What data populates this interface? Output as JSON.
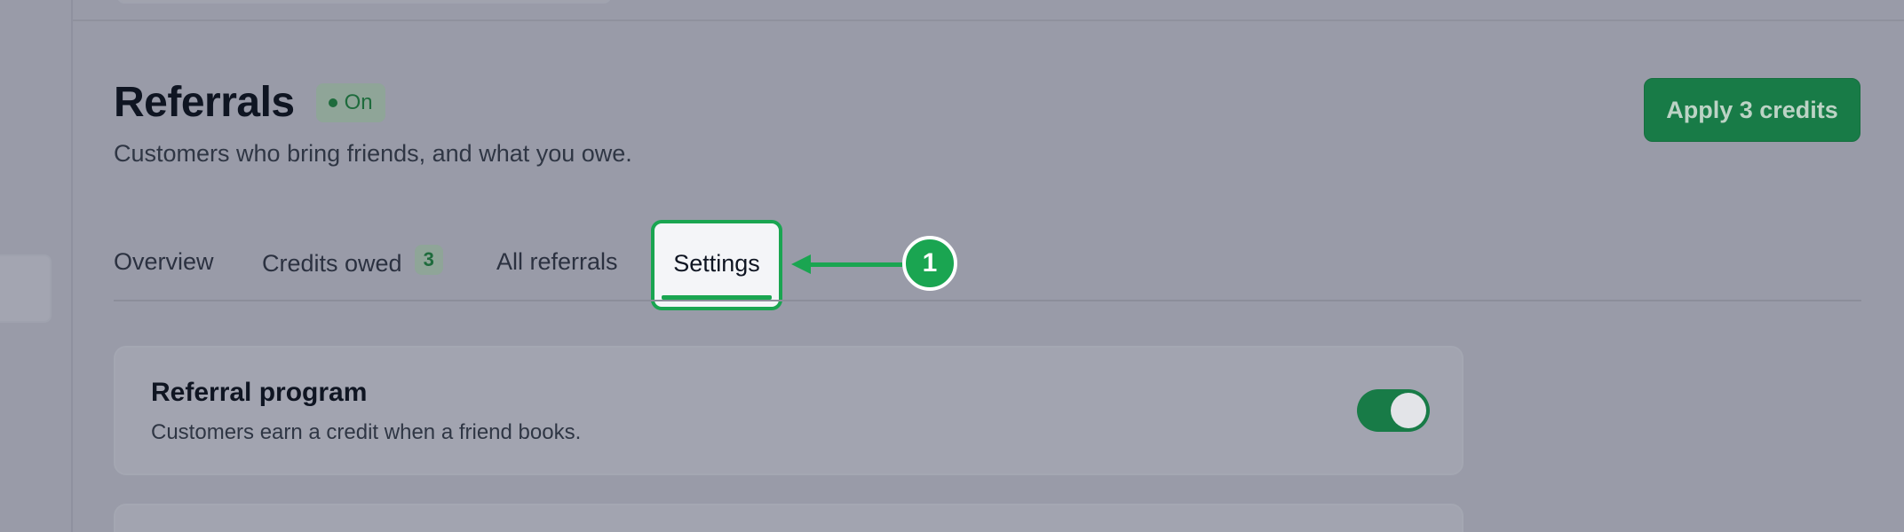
{
  "header": {
    "title": "Referrals",
    "status_badge": "On",
    "subtitle": "Customers who bring friends, and what you owe.",
    "apply_button": "Apply 3 credits"
  },
  "tabs": [
    {
      "label": "Overview"
    },
    {
      "label": "Credits owed",
      "count": "3"
    },
    {
      "label": "All referrals"
    },
    {
      "label": "Settings",
      "active": true
    }
  ],
  "annotation": {
    "marker": "1"
  },
  "settings": {
    "referral_program": {
      "title": "Referral program",
      "description": "Customers earn a credit when a friend books.",
      "enabled": true
    }
  },
  "colors": {
    "accent": "#1aa551",
    "primary_button": "#187b47"
  }
}
